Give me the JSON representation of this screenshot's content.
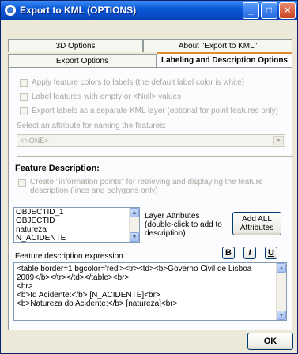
{
  "window": {
    "title": "Export to KML (OPTIONS)",
    "buttons": {
      "minimize": "_",
      "maximize": "□",
      "close": "✕"
    }
  },
  "tabs": {
    "back": [
      "3D Options",
      "About \"Export to KML\""
    ],
    "front": [
      "Export Options",
      "Labeling and Description Options"
    ]
  },
  "labeling": {
    "checkboxes": [
      "Apply feature colors to labels (the default label color is white)",
      "Label features with empty or <Null> values",
      "Export labels as a separate KML layer (optional for point features only)"
    ],
    "attribute_prompt": "Select an attribute for naming the features:",
    "attribute_value": "<NONE>"
  },
  "description": {
    "heading": "Feature Description:",
    "info_points_checkbox": "Create \"information points\" for retrieving and displaying the feature description (lines and polygons only)",
    "attributes": [
      "OBJECTID_1",
      "OBJECTID",
      "natureza",
      "N_ACIDENTE"
    ],
    "layer_attributes_label": "Layer Attributes (double-click to add to description)",
    "add_all_label": "Add ALL Attributes",
    "expression_label": "Feature description expression :",
    "format_buttons": {
      "bold": "B",
      "italic": "I",
      "underline": "U"
    },
    "expression_lines": [
      "<table border=1 bgcolor='red'><tr><td><b>Governo Civil de Lisboa",
      "2009</b></tr></td></table><br>",
      "<br>",
      "<b>Id Acidente:</b> [N_ACIDENTE]<br>",
      "<b>Natureza do Acidente:</b> [natureza]<br>"
    ]
  },
  "footer": {
    "ok_label": "OK"
  }
}
